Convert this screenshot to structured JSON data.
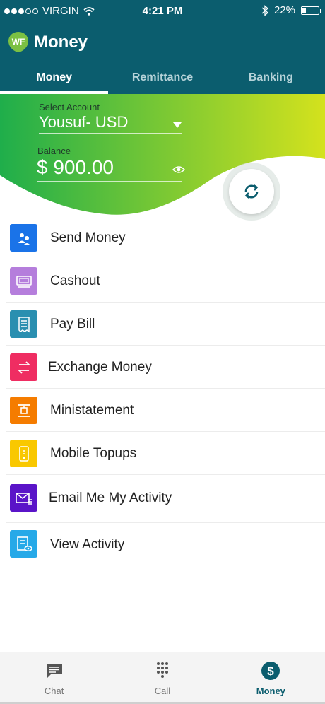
{
  "status_bar": {
    "carrier": "VIRGIN",
    "time": "4:21 PM",
    "battery": "22%",
    "battery_level": 0.22,
    "icons": [
      "signal-dots-icon",
      "wifi-icon",
      "bluetooth-icon",
      "battery-icon"
    ]
  },
  "header": {
    "logo_text": "WF",
    "title": "Money",
    "tabs": [
      {
        "label": "Money",
        "active": true
      },
      {
        "label": "Remittance",
        "active": false
      },
      {
        "label": "Banking",
        "active": false
      }
    ]
  },
  "account": {
    "select_label": "Select Account",
    "selected": "Yousuf- USD",
    "balance_label": "Balance",
    "balance": "$ 900.00"
  },
  "menu": {
    "items": [
      {
        "label": "Send Money",
        "icon": "send-money-icon",
        "color": "#1a73e8"
      },
      {
        "label": "Cashout",
        "icon": "cashout-icon",
        "color": "#b57edc"
      },
      {
        "label": "Pay Bill",
        "icon": "pay-bill-icon",
        "color": "#2a8fb0"
      },
      {
        "label": "Exchange Money",
        "icon": "exchange-icon",
        "color": "#ef2d62"
      },
      {
        "label": "Ministatement",
        "icon": "ministatement-icon",
        "color": "#f57c00"
      },
      {
        "label": "Mobile Topups",
        "icon": "mobile-topup-icon",
        "color": "#f9c800"
      },
      {
        "label": "Email Me My Activity",
        "icon": "email-activity-icon",
        "color": "#5a14c8"
      },
      {
        "label": "View Activity",
        "icon": "view-activity-icon",
        "color": "#26a9e8"
      }
    ]
  },
  "bottom_nav": {
    "items": [
      {
        "label": "Chat",
        "icon": "chat-icon",
        "active": false
      },
      {
        "label": "Call",
        "icon": "dialpad-icon",
        "active": false
      },
      {
        "label": "Money",
        "icon": "dollar-icon",
        "active": true
      }
    ]
  },
  "colors": {
    "header": "#0b5d6e",
    "hero_start": "#1fae4b",
    "hero_end": "#d4e21d",
    "active_nav": "#0b5d6e"
  }
}
